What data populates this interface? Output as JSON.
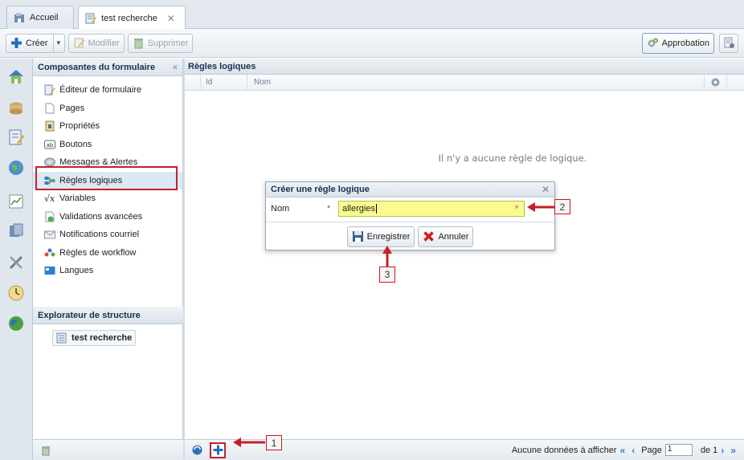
{
  "tabs": [
    {
      "label": "Accueil",
      "icon": "home-icon",
      "active": false
    },
    {
      "label": "test recherche",
      "icon": "form-edit-icon",
      "active": true,
      "close": "✕"
    }
  ],
  "toolbar": {
    "create_label": "Créer",
    "modify_label": "Modifier",
    "delete_label": "Supprimer",
    "approval_label": "Approbation"
  },
  "left_panel": {
    "title": "Composantes du formulaire",
    "collapse": "«",
    "items": [
      {
        "label": "Éditeur de formulaire",
        "icon": "form-editor-icon"
      },
      {
        "label": "Pages",
        "icon": "pages-icon"
      },
      {
        "label": "Propriétés",
        "icon": "properties-icon"
      },
      {
        "label": "Boutons",
        "icon": "buttons-icon"
      },
      {
        "label": "Messages & Alertes",
        "icon": "messages-icon"
      },
      {
        "label": "Règles logiques",
        "icon": "logic-rules-icon",
        "selected": true
      },
      {
        "label": "Variables",
        "icon": "variables-icon"
      },
      {
        "label": "Validations avancées",
        "icon": "validations-icon"
      },
      {
        "label": "Notifications courriel",
        "icon": "mail-icon"
      },
      {
        "label": "Règles de workflow",
        "icon": "workflow-icon"
      },
      {
        "label": "Langues",
        "icon": "languages-icon"
      }
    ],
    "structure_title": "Explorateur de structure",
    "structure_node": "test recherche"
  },
  "main": {
    "title": "Règles logiques",
    "col_id": "Id",
    "col_nom": "Nom",
    "empty_message": "Il n'y a aucune règle de logique.",
    "footer_status": "Aucune données à afficher",
    "page_label": "Page",
    "page_value": "1",
    "page_of": "de 1"
  },
  "dialog": {
    "title": "Créer une règle logique",
    "close": "✕",
    "field_label": "Nom",
    "required": "*",
    "field_value": "allergies",
    "clear": "×",
    "save_label": "Enregistrer",
    "cancel_label": "Annuler"
  },
  "callouts": [
    "1",
    "2",
    "3"
  ],
  "colors": {
    "accent": "#c4202a",
    "header": "#dbe3eb",
    "input_highlight": "#fafa8e"
  }
}
